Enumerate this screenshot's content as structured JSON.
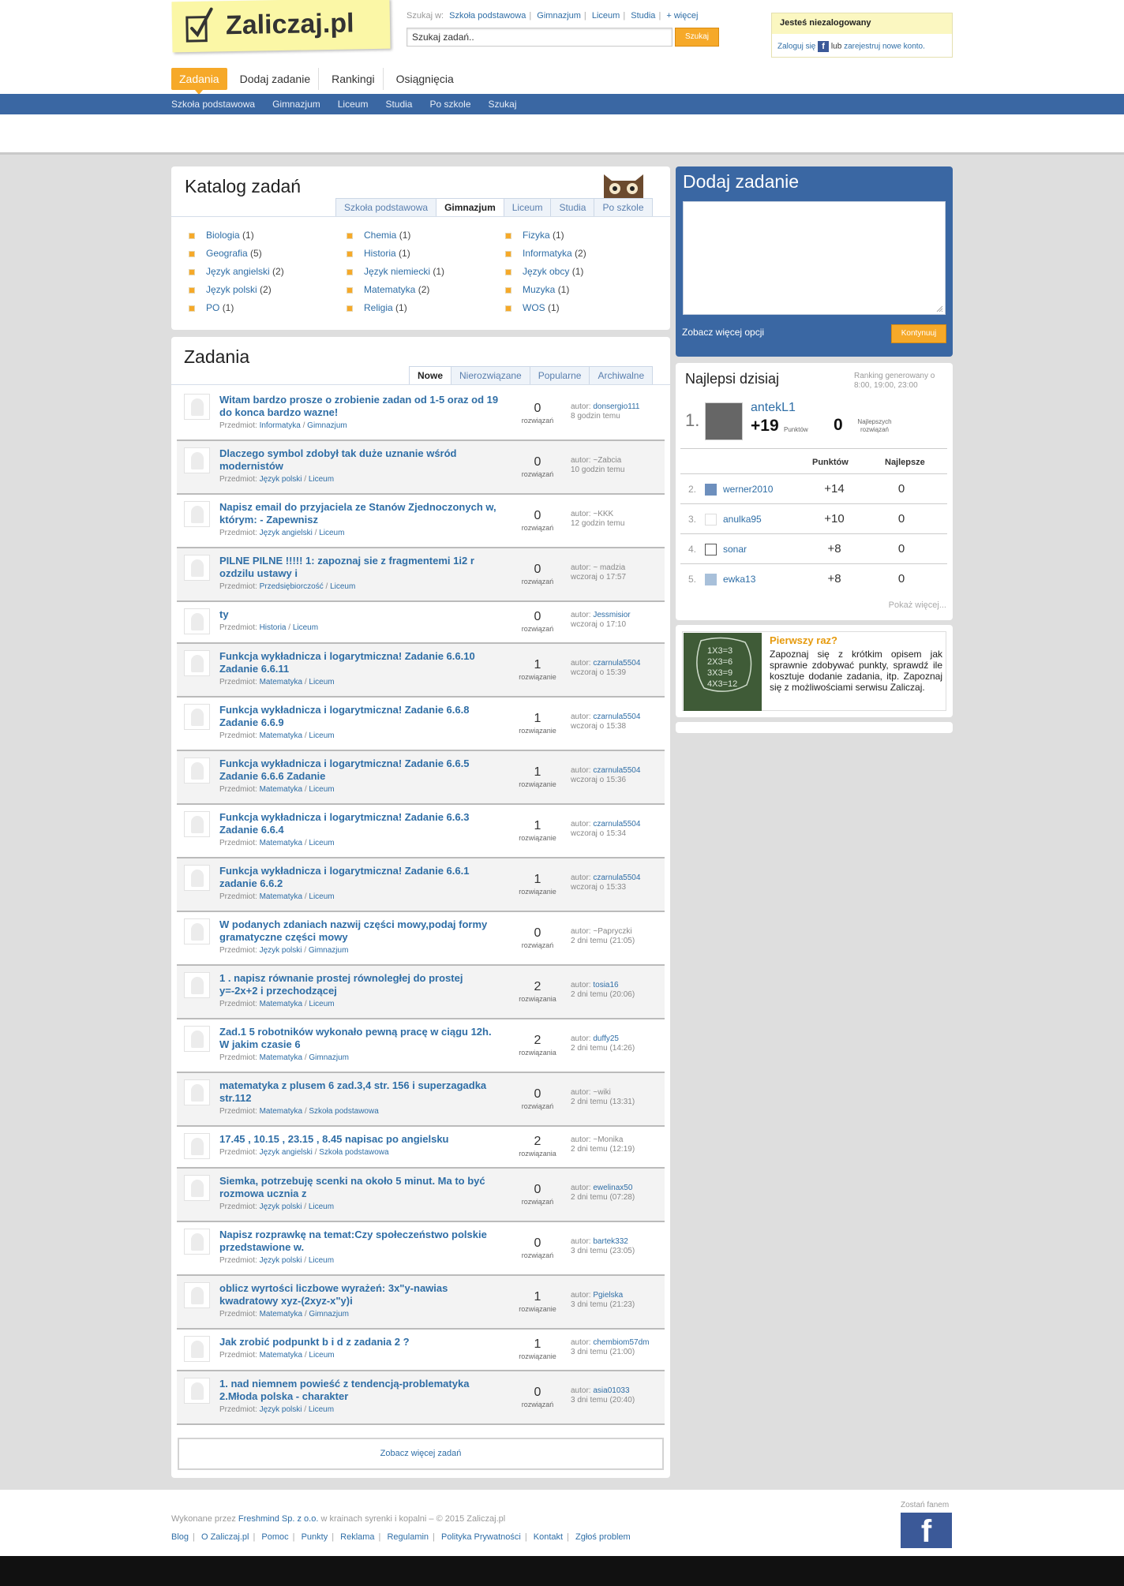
{
  "logo": {
    "text": "Zaliczaj.pl"
  },
  "search": {
    "label": "Szukaj w:",
    "scopes": [
      "Szkoła podstawowa",
      "Gimnazjum",
      "Liceum",
      "Studia",
      "+ więcej"
    ],
    "placeholder": "Szukaj zadań..",
    "button": "Szukaj"
  },
  "login": {
    "title": "Jesteś niezalogowany",
    "login_link": "Zaloguj się",
    "or": "lub",
    "register_link": "zarejestruj nowe konto."
  },
  "nav": {
    "items": [
      "Zadania",
      "Dodaj zadanie",
      "Rankingi",
      "Osiągnięcia"
    ]
  },
  "subnav": {
    "items": [
      "Szkoła podstawowa",
      "Gimnazjum",
      "Liceum",
      "Studia",
      "Po szkole",
      "Szukaj"
    ]
  },
  "catalog": {
    "title": "Katalog zadań",
    "tabs": [
      "Szkoła podstawowa",
      "Gimnazjum",
      "Liceum",
      "Studia",
      "Po szkole"
    ],
    "columns": [
      [
        {
          "name": "Biologia",
          "count": "(1)"
        },
        {
          "name": "Geografia",
          "count": "(5)"
        },
        {
          "name": "Język angielski",
          "count": "(2)"
        },
        {
          "name": "Język polski",
          "count": "(2)"
        },
        {
          "name": "PO",
          "count": "(1)"
        }
      ],
      [
        {
          "name": "Chemia",
          "count": "(1)"
        },
        {
          "name": "Historia",
          "count": "(1)"
        },
        {
          "name": "Język niemiecki",
          "count": "(1)"
        },
        {
          "name": "Matematyka",
          "count": "(2)"
        },
        {
          "name": "Religia",
          "count": "(1)"
        }
      ],
      [
        {
          "name": "Fizyka",
          "count": "(1)"
        },
        {
          "name": "Informatyka",
          "count": "(2)"
        },
        {
          "name": "Język obcy",
          "count": "(1)"
        },
        {
          "name": "Muzyka",
          "count": "(1)"
        },
        {
          "name": "WOS",
          "count": "(1)"
        }
      ]
    ]
  },
  "tasks": {
    "title": "Zadania",
    "tabs": [
      "Nowe",
      "Nierozwiązane",
      "Popularne",
      "Archiwalne"
    ],
    "subject_label": "Przedmiot:",
    "count_label": "rozwiązań",
    "count_label_one": "rozwiązanie",
    "count_label_few": "rozwiązania",
    "author_label": "autor:",
    "items": [
      {
        "title": "Witam bardzo prosze o zrobienie zadan od 1-5 oraz od 19 do konca bardzo wazne!",
        "subject": "Informatyka",
        "level": "Gimnazjum",
        "count": "0",
        "count_label": "rozwiązań",
        "author": "donsergio111",
        "author_linked": true,
        "time": "8 godzin temu"
      },
      {
        "title": "Dlaczego symbol zdobył tak duże uznanie wśród modernistów",
        "subject": "Język polski",
        "level": "Liceum",
        "count": "0",
        "count_label": "rozwiązań",
        "author": "~Zabcia",
        "author_linked": false,
        "time": "10 godzin temu"
      },
      {
        "title": "Napisz email do przyjaciela ze Stanów Zjednoczonych w, którym: - Zapewnisz",
        "subject": "Język angielski",
        "level": "Liceum",
        "count": "0",
        "count_label": "rozwiązań",
        "author": "~KKK",
        "author_linked": false,
        "time": "12 godzin temu"
      },
      {
        "title": "PILNE PILNE !!!!! 1: zapoznaj sie z fragmentemi 1i2 r ozdzilu ustawy i",
        "subject": "Przedsiębiorczość",
        "level": "Liceum",
        "count": "0",
        "count_label": "rozwiązań",
        "author": "~ madzia",
        "author_linked": false,
        "time": "wczoraj o 17:57"
      },
      {
        "title": "ty",
        "subject": "Historia",
        "level": "Liceum",
        "count": "0",
        "count_label": "rozwiązań",
        "author": "Jessmisior",
        "author_linked": true,
        "time": "wczoraj o 17:10"
      },
      {
        "title": "Funkcja wykładnicza i logarytmiczna! Zadanie 6.6.10 Zadanie 6.6.11",
        "subject": "Matematyka",
        "level": "Liceum",
        "count": "1",
        "count_label": "rozwiązanie",
        "author": "czarnula5504",
        "author_linked": true,
        "time": "wczoraj o 15:39"
      },
      {
        "title": "Funkcja wykładnicza i logarytmiczna! Zadanie 6.6.8 Zadanie 6.6.9",
        "subject": "Matematyka",
        "level": "Liceum",
        "count": "1",
        "count_label": "rozwiązanie",
        "author": "czarnula5504",
        "author_linked": true,
        "time": "wczoraj o 15:38"
      },
      {
        "title": "Funkcja wykładnicza i logarytmiczna! Zadanie 6.6.5 Zadanie 6.6.6 Zadanie",
        "subject": "Matematyka",
        "level": "Liceum",
        "count": "1",
        "count_label": "rozwiązanie",
        "author": "czarnula5504",
        "author_linked": true,
        "time": "wczoraj o 15:36"
      },
      {
        "title": "Funkcja wykładnicza i logarytmiczna! Zadanie 6.6.3 Zadanie 6.6.4",
        "subject": "Matematyka",
        "level": "Liceum",
        "count": "1",
        "count_label": "rozwiązanie",
        "author": "czarnula5504",
        "author_linked": true,
        "time": "wczoraj o 15:34"
      },
      {
        "title": "Funkcja wykładnicza i logarytmiczna! Zadanie 6.6.1 zadanie 6.6.2",
        "subject": "Matematyka",
        "level": "Liceum",
        "count": "1",
        "count_label": "rozwiązanie",
        "author": "czarnula5504",
        "author_linked": true,
        "time": "wczoraj o 15:33"
      },
      {
        "title": "W podanych zdaniach nazwij części mowy,podaj formy gramatyczne części mowy",
        "subject": "Język polski",
        "level": "Gimnazjum",
        "count": "0",
        "count_label": "rozwiązań",
        "author": "~Papryczki",
        "author_linked": false,
        "time": "2 dni temu (21:05)"
      },
      {
        "title": "1 . napisz równanie prostej równoległej do prostej y=-2x+2 i przechodzącej",
        "subject": "Matematyka",
        "level": "Liceum",
        "count": "2",
        "count_label": "rozwiązania",
        "author": "tosia16",
        "author_linked": true,
        "time": "2 dni temu (20:06)"
      },
      {
        "title": "Zad.1 5 robotników wykonało pewną pracę w ciągu 12h. W jakim czasie 6",
        "subject": "Matematyka",
        "level": "Gimnazjum",
        "count": "2",
        "count_label": "rozwiązania",
        "author": "duffy25",
        "author_linked": true,
        "time": "2 dni temu (14:26)"
      },
      {
        "title": "matematyka z plusem 6 zad.3,4 str. 156 i superzagadka str.112",
        "subject": "Matematyka",
        "level": "Szkoła podstawowa",
        "count": "0",
        "count_label": "rozwiązań",
        "author": "~wiki",
        "author_linked": false,
        "time": "2 dni temu (13:31)"
      },
      {
        "title": "17.45 , 10.15 , 23.15 , 8.45 napisac po angielsku",
        "subject": "Język angielski",
        "level": "Szkoła podstawowa",
        "count": "2",
        "count_label": "rozwiązania",
        "author": "~Monika",
        "author_linked": false,
        "time": "2 dni temu (12:19)"
      },
      {
        "title": "Siemka, potrzebuję scenki na około 5 minut. Ma to być rozmowa ucznia z",
        "subject": "Język polski",
        "level": "Liceum",
        "count": "0",
        "count_label": "rozwiązań",
        "author": "ewelinax50",
        "author_linked": true,
        "time": "2 dni temu (07:28)"
      },
      {
        "title": "Napisz rozprawkę na temat:Czy społeczeństwo polskie przedstawione w.",
        "subject": "Język polski",
        "level": "Liceum",
        "count": "0",
        "count_label": "rozwiązań",
        "author": "bartek332",
        "author_linked": true,
        "time": "3 dni temu (23:05)"
      },
      {
        "title": "oblicz wyrtości liczbowe wyrażeń: 3x\"y-nawias kwadratowy xyz-(2xyz-x\"y)i",
        "subject": "Matematyka",
        "level": "Gimnazjum",
        "count": "1",
        "count_label": "rozwiązanie",
        "author": "Pgielska",
        "author_linked": true,
        "time": "3 dni temu (21:23)"
      },
      {
        "title": "Jak zrobić podpunkt b i d z zadania 2 ?",
        "subject": "Matematyka",
        "level": "Liceum",
        "count": "1",
        "count_label": "rozwiązanie",
        "author": "chembiom57dm",
        "author_linked": true,
        "time": "3 dni temu (21:00)"
      },
      {
        "title": "1. nad niemnem powieść z tendencją-problematyka 2.Młoda polska - charakter",
        "subject": "Język polski",
        "level": "Liceum",
        "count": "0",
        "count_label": "rozwiązań",
        "author": "asia01033",
        "author_linked": true,
        "time": "3 dni temu (20:40)"
      }
    ],
    "more": "Zobacz więcej zadań"
  },
  "add_task": {
    "title": "Dodaj zadanie",
    "more_options": "Zobacz więcej opcji",
    "button": "Kontynuuj"
  },
  "best": {
    "title": "Najlepsi dzisiaj",
    "generated": "Ranking generowany o 8:00, 19:00, 23:00",
    "top": {
      "rank": "1.",
      "name": "antekL1",
      "points": "+19",
      "points_label": "Punktów",
      "best": "0",
      "best_label": "Najlepszych rozwiązań"
    },
    "col_points": "Punktów",
    "col_best": "Najlepsze",
    "rows": [
      {
        "rank": "2.",
        "name": "werner2010",
        "points": "+14",
        "best": "0"
      },
      {
        "rank": "3.",
        "name": "anulka95",
        "points": "+10",
        "best": "0"
      },
      {
        "rank": "4.",
        "name": "sonar",
        "points": "+8",
        "best": "0"
      },
      {
        "rank": "5.",
        "name": "ewka13",
        "points": "+8",
        "best": "0"
      }
    ],
    "more": "Pokaż więcej..."
  },
  "first_time": {
    "title": "Pierwszy raz?",
    "text": "Zapoznaj się z krótkim opisem jak sprawnie zdobywać punkty, sprawdź ile kosztuje dodanie zadania, itp. Zapoznaj się z możliwościami serwisu Zaliczaj.",
    "image_text": "1X3=3 2X3=6 3X3=9 4X3=12"
  },
  "footer": {
    "made_by": "Wykonane przez",
    "company": "Freshmind Sp. z o.o.",
    "tagline": "w krainach syrenki i kopalni – © 2015 Zaliczaj.pl",
    "links": [
      "Blog",
      "O Zaliczaj.pl",
      "Pomoc",
      "Punkty",
      "Reklama",
      "Regulamin",
      "Polityka Prywatności",
      "Kontakt",
      "Zgłoś problem"
    ],
    "fan_label": "Zostań fanem"
  },
  "colors": {
    "accent": "#f6a929",
    "nav_blue": "#3a67a3",
    "link": "#2f6ea6"
  },
  "icons": [
    "check-logo-icon",
    "facebook-icon",
    "owl-mascot-icon",
    "user-avatar-icon",
    "resize-grip-icon"
  ]
}
